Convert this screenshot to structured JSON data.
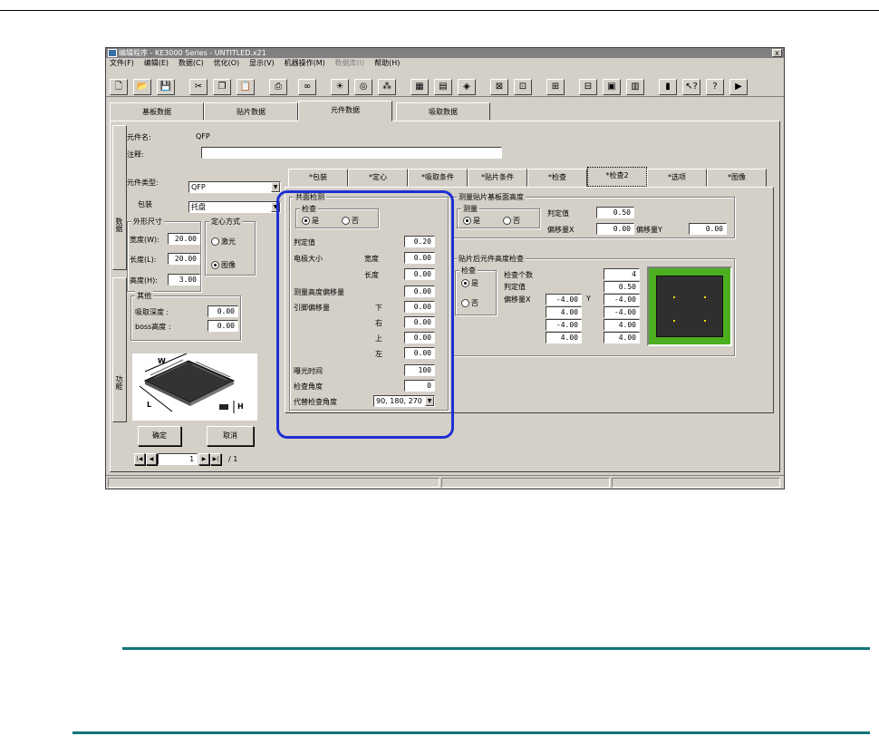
{
  "window": {
    "title": "编辑程序 - KE3000 Series - UNTITLED.x21",
    "close_label": "x"
  },
  "menu": [
    {
      "label": "文件(F)",
      "disabled": false
    },
    {
      "label": "编辑(E)",
      "disabled": false
    },
    {
      "label": "数据(C)",
      "disabled": false
    },
    {
      "label": "优化(O)",
      "disabled": false
    },
    {
      "label": "显示(V)",
      "disabled": false
    },
    {
      "label": "机器操作(M)",
      "disabled": false
    },
    {
      "label": "数据库(I)",
      "disabled": true
    },
    {
      "label": "帮助(H)",
      "disabled": false
    }
  ],
  "toolbar": {
    "icons": [
      "new-file-icon",
      "open-folder-icon",
      "save-icon",
      "cut-icon",
      "copy-icon",
      "paste-icon",
      "print-icon",
      "optimize-icon",
      "light-bulb-icon",
      "component-icon",
      "group-icon",
      "board-icon",
      "feeder-icon",
      "nozzle-icon",
      "placement-icon",
      "check-icon",
      "align-icon",
      "mark-icon",
      "tray-icon",
      "barcode-icon",
      "book-icon",
      "context-help-icon",
      "help-icon",
      "exit-icon"
    ],
    "glyphs": [
      "🗋",
      "📂",
      "💾",
      "✂",
      "❐",
      "📋",
      "⎙",
      "∞",
      "☀",
      "◎",
      "⁂",
      "▦",
      "▤",
      "◈",
      "⊠",
      "⊡",
      "⊞",
      "⊟",
      "▣",
      "▥",
      "▮",
      "↖?",
      "?",
      "▶"
    ]
  },
  "main_tabs": [
    "基板数据",
    "贴片数据",
    "元件数据",
    "吸取数据"
  ],
  "main_tab_active": 2,
  "vtabs": {
    "top": "数据",
    "bottom": "功能"
  },
  "component": {
    "name_label": "元件名:",
    "name_value": "QFP",
    "comment_label": "注释:",
    "comment_value": "",
    "type_label": "元件类型:",
    "type_value": "QFP",
    "pack_label": "包装",
    "pack_value": "托盘"
  },
  "outline": {
    "title": "外形尺寸",
    "width_label": "宽度(W):",
    "width_value": "20.00",
    "length_label": "长度(L):",
    "length_value": "20.00",
    "height_label": "高度(H):",
    "height_value": "3.00"
  },
  "centering": {
    "title": "定心方式",
    "laser_label": "激光",
    "image_label": "图像",
    "selected": "image"
  },
  "other": {
    "title": "其他",
    "pick_depth_label": "吸取深度 :",
    "pick_depth_value": "0.00",
    "boss_label": "boss高度 :",
    "boss_value": "0.00"
  },
  "qfp_labels": {
    "w": "W",
    "l": "L",
    "h": "H"
  },
  "buttons": {
    "ok": "确定",
    "cancel": "取消"
  },
  "pager": {
    "first": "|◀",
    "prev": "◀",
    "current": "1",
    "next": "▶",
    "last": "▶|",
    "total": "/ 1"
  },
  "sub_tabs": [
    "*包装",
    "*定心",
    "*吸取条件",
    "*贴片条件",
    "*检查",
    "*检查2",
    "*选项",
    "*图像"
  ],
  "sub_tab_active": 5,
  "coplanarity": {
    "title": "共面检测",
    "check_title": "检查",
    "yes": "是",
    "no": "否",
    "threshold_label": "判定值",
    "threshold_value": "0.20",
    "electrode_label": "电极大小",
    "electrode_width_label": "宽度",
    "electrode_width_value": "0.00",
    "electrode_length_label": "长度",
    "electrode_length_value": "0.00",
    "height_offset_label": "测量高度偏移量",
    "height_offset_value": "0.00",
    "lead_offset_label": "引脚偏移量",
    "lead_down_label": "下",
    "lead_down_value": "0.00",
    "lead_right_label": "右",
    "lead_right_value": "0.00",
    "lead_up_label": "上",
    "lead_up_value": "0.00",
    "lead_left_label": "左",
    "lead_left_value": "0.00",
    "exposure_label": "曝光时间",
    "exposure_value": "100",
    "angle_label": "检查角度",
    "angle_value": "0",
    "alt_angle_label": "代替检查角度",
    "alt_angle_value": "90, 180, 270"
  },
  "board_height": {
    "title": "测量贴片基板面高度",
    "measure_title": "测量",
    "yes": "是",
    "no": "否",
    "threshold_label": "判定值",
    "threshold_value": "0.50",
    "offset_x_label": "偏移量X",
    "offset_x_value": "0.00",
    "offset_y_label": "偏移量Y",
    "offset_y_value": "0.00"
  },
  "post_height": {
    "title": "贴片后元件高度检查",
    "check_title": "检查",
    "yes": "是",
    "no": "否",
    "count_label": "检查个数",
    "count_value": "4",
    "threshold_label": "判定值",
    "threshold_value": "0.50",
    "offset_x_label": "偏移量X",
    "y_label": "Y",
    "rows": [
      {
        "x": "-4.00",
        "y": "-4.00"
      },
      {
        "x": "4.00",
        "y": "-4.00"
      },
      {
        "x": "-4.00",
        "y": "4.00"
      },
      {
        "x": "4.00",
        "y": "4.00"
      }
    ],
    "preview_colors": {
      "board": "#4caf20",
      "chip": "#2f2f2f",
      "dot": "#e8e000"
    }
  },
  "colors": {
    "highlight": "#1f2fd4",
    "rule": "#13757a",
    "window_bg": "#d4d0c8"
  }
}
